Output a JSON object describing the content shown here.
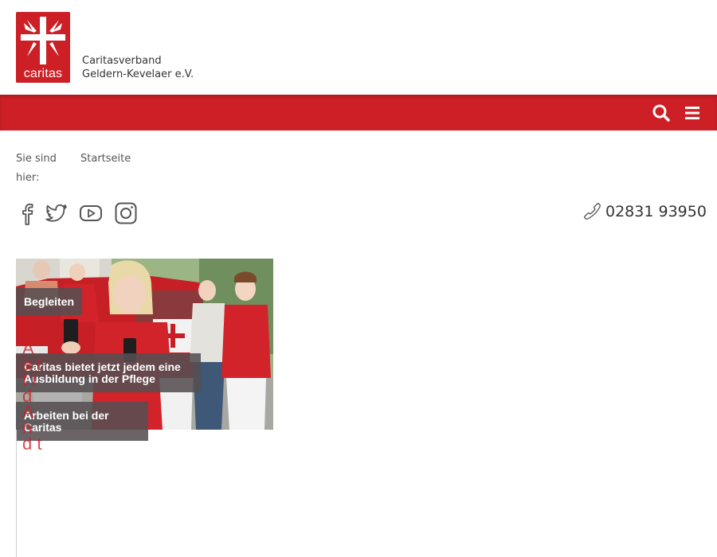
{
  "header": {
    "logo_text": "caritas",
    "org_name_line1": "Caritasverband",
    "org_name_line2": "Geldern-Kevelaer e.V."
  },
  "colors": {
    "brand_red": "#cc1f26",
    "tag_bg": "#554e52"
  },
  "navbar": {
    "search_icon": "search-icon",
    "menu_icon": "hamburger-menu-icon"
  },
  "breadcrumb": {
    "label": "Sie sind hier:",
    "current": "Startseite"
  },
  "social": [
    "facebook-icon",
    "twitter-icon",
    "youtube-icon",
    "instagram-icon"
  ],
  "contact": {
    "phone": "02831 93950",
    "phone_icon": "phone-icon"
  },
  "teaser": {
    "tags": [
      {
        "label": "Begleiten"
      },
      {
        "label": "Caritas bietet jetzt jedem eine Ausbildung in der Pflege"
      },
      {
        "label": "Arbeiten bei der Caritas"
      }
    ],
    "overflow_text": "H I A a t t i d A n d t"
  }
}
